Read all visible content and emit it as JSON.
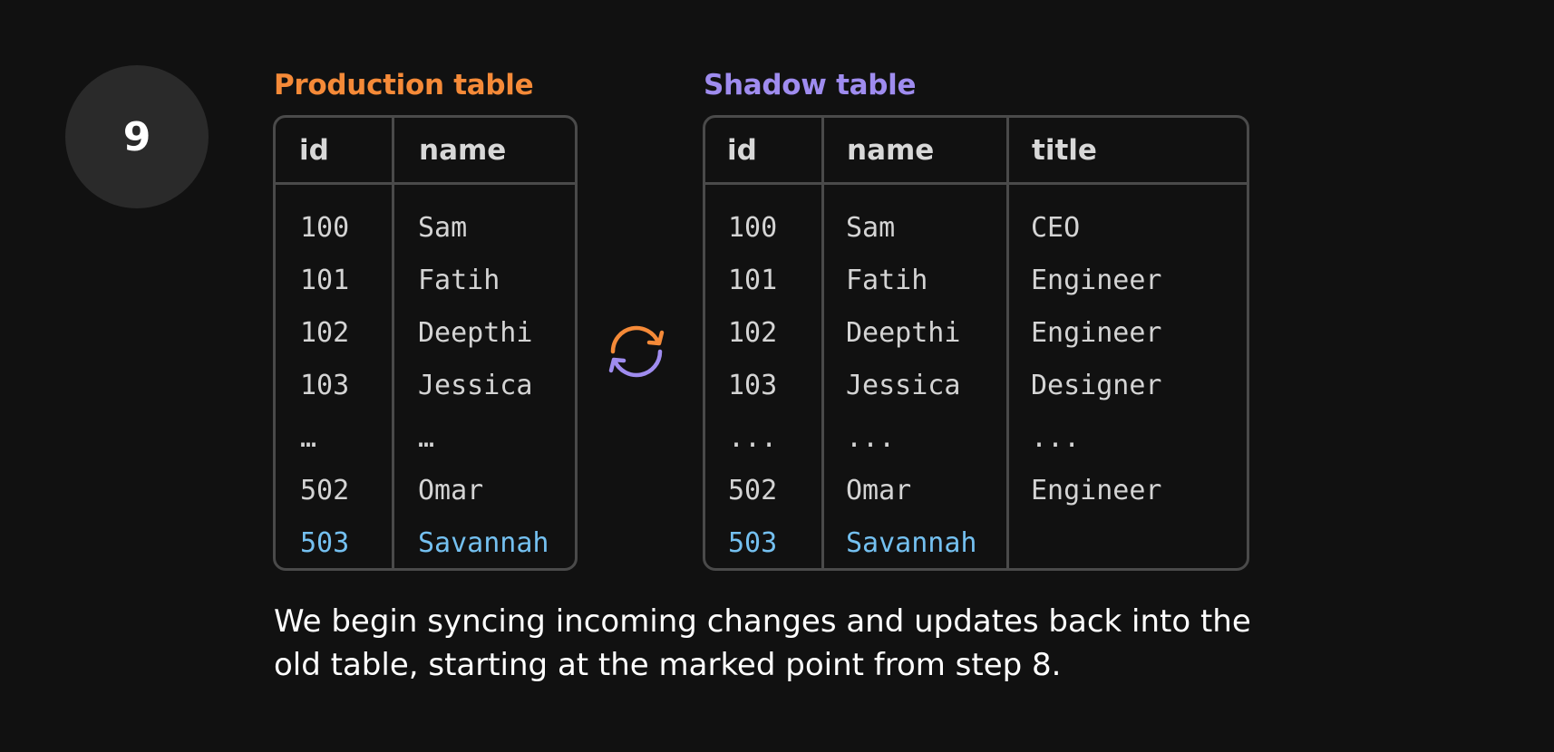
{
  "step": {
    "number": "9"
  },
  "colors": {
    "background": "#111111",
    "production_accent": "#f58a38",
    "shadow_accent": "#9f8cef",
    "highlight_row": "#74c0f0",
    "table_border": "#4a4a4a"
  },
  "production_table": {
    "title": "Production table",
    "headers": {
      "id": "id",
      "name": "name"
    },
    "rows": [
      {
        "id": "100",
        "name": "Sam",
        "highlight": false
      },
      {
        "id": "101",
        "name": "Fatih",
        "highlight": false
      },
      {
        "id": "102",
        "name": "Deepthi",
        "highlight": false
      },
      {
        "id": "103",
        "name": "Jessica",
        "highlight": false
      },
      {
        "id": "…",
        "name": "…",
        "highlight": false
      },
      {
        "id": "502",
        "name": "Omar",
        "highlight": false
      },
      {
        "id": "503",
        "name": "Savannah",
        "highlight": true
      }
    ]
  },
  "shadow_table": {
    "title": "Shadow table",
    "headers": {
      "id": "id",
      "name": "name",
      "title": "title"
    },
    "rows": [
      {
        "id": "100",
        "name": "Sam",
        "title": "CEO",
        "highlight": false
      },
      {
        "id": "101",
        "name": "Fatih",
        "title": "Engineer",
        "highlight": false
      },
      {
        "id": "102",
        "name": "Deepthi",
        "title": "Engineer",
        "highlight": false
      },
      {
        "id": "103",
        "name": "Jessica",
        "title": "Designer",
        "highlight": false
      },
      {
        "id": "...",
        "name": "...",
        "title": "...",
        "highlight": false
      },
      {
        "id": "502",
        "name": "Omar",
        "title": "Engineer",
        "highlight": false
      },
      {
        "id": "503",
        "name": "Savannah",
        "title": "",
        "highlight": true
      }
    ]
  },
  "sync_icon": {
    "icon": "sync-arrows-icon"
  },
  "caption": {
    "line1": "We begin syncing incoming changes and updates back into the",
    "line2": "old table, starting at the marked point from step 8."
  }
}
